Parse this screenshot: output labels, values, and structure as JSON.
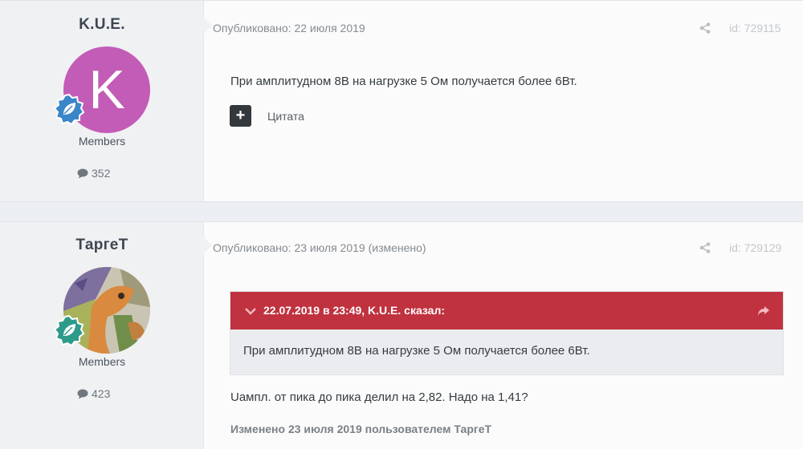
{
  "posts": [
    {
      "author": "K.U.E.",
      "avatar_letter": "K",
      "avatar_color": "#c35cb6",
      "badge_color": "#3a86c8",
      "group": "Members",
      "post_count": "352",
      "published": "Опубликовано: 22 июля 2019",
      "post_id": "id: 729115",
      "content": "При амплитудном 8В на нагрузке 5 Ом получается более 6Вт.",
      "quote_label": "Цитата"
    },
    {
      "author": "ТаргеТ",
      "badge_color": "#2e9a8a",
      "group": "Members",
      "post_count": "423",
      "published": "Опубликовано: 23 июля 2019 (изменено)",
      "post_id": "id: 729129",
      "quote": {
        "header": "22.07.2019 в 23:49, K.U.E. сказал:",
        "body": "При амплитудном 8В на нагрузке 5 Ом получается более 6Вт."
      },
      "content": "Uампл. от пика до пика делил на 2,82. Надо на 1,41?",
      "edited_note": "Изменено 23 июля 2019 пользователем ТаргеТ"
    }
  ],
  "colors": {
    "quote_header": "#c0323f",
    "quote_body_bg": "#ebecef"
  },
  "icons": [
    "speech-bubble-icon",
    "share-icon",
    "plus-icon",
    "chevron-down-icon",
    "reply-arrow-icon",
    "leaf-badge-icon"
  ]
}
